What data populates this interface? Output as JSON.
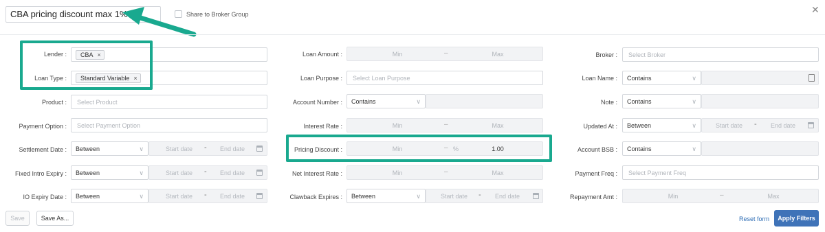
{
  "header": {
    "title": "CBA pricing discount max 1%",
    "share_label": "Share to Broker Group",
    "close_icon": "close-icon"
  },
  "left": {
    "lender": {
      "label": "Lender",
      "tags": [
        "CBA"
      ]
    },
    "loan_type": {
      "label": "Loan Type",
      "tags": [
        "Standard Variable"
      ]
    },
    "product": {
      "label": "Product",
      "placeholder": "Select Product"
    },
    "payment_option": {
      "label": "Payment Option",
      "placeholder": "Select Payment Option"
    },
    "settlement_date": {
      "label": "Settlement Date",
      "mode": "Between",
      "start": "Start date",
      "end": "End date"
    },
    "fixed_intro_expiry": {
      "label": "Fixed Intro Expiry",
      "mode": "Between",
      "start": "Start date",
      "end": "End date"
    },
    "io_expiry_date": {
      "label": "IO Expiry Date",
      "mode": "Between",
      "start": "Start date",
      "end": "End date"
    }
  },
  "middle": {
    "loan_amount": {
      "label": "Loan Amount",
      "min": "Min",
      "max": "Max"
    },
    "loan_purpose": {
      "label": "Loan Purpose",
      "placeholder": "Select Loan Purpose"
    },
    "account_number": {
      "label": "Account Number",
      "mode": "Contains"
    },
    "interest_rate": {
      "label": "Interest Rate",
      "min": "Min",
      "max": "Max"
    },
    "pricing_discount": {
      "label": "Pricing Discount",
      "min": "Min",
      "unit": "%",
      "max_value": "1.00"
    },
    "net_interest_rate": {
      "label": "Net Interest Rate",
      "min": "Min",
      "max": "Max"
    },
    "clawback_expires": {
      "label": "Clawback Expires",
      "mode": "Between",
      "start": "Start date",
      "end": "End date"
    }
  },
  "right": {
    "broker": {
      "label": "Broker",
      "placeholder": "Select Broker"
    },
    "loan_name": {
      "label": "Loan Name",
      "mode": "Contains"
    },
    "note": {
      "label": "Note",
      "mode": "Contains"
    },
    "updated_at": {
      "label": "Updated At",
      "mode": "Between",
      "start": "Start date",
      "end": "End date"
    },
    "account_bsb": {
      "label": "Account BSB",
      "mode": "Contains"
    },
    "payment_freq": {
      "label": "Payment Freq",
      "placeholder": "Select Payment Freq"
    },
    "repayment_amt": {
      "label": "Repayment Amt",
      "min": "Min",
      "max": "Max"
    }
  },
  "footer": {
    "save": "Save",
    "save_as": "Save As...",
    "reset": "Reset form",
    "apply": "Apply Filters"
  },
  "colors": {
    "highlight": "#19a98f",
    "primary": "#3f73b8",
    "link": "#2f6eb5"
  }
}
